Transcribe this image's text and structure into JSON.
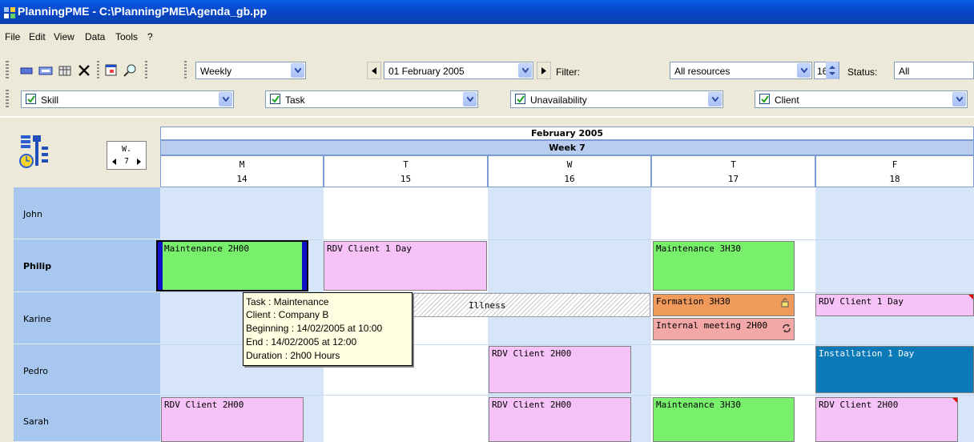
{
  "window": {
    "title": "PlanningPME - C:\\PlanningPME\\Agenda_gb.pp"
  },
  "menu": [
    "File",
    "Edit",
    "View",
    "Data",
    "Tools",
    "?"
  ],
  "toolbar": {
    "view_mode": "Weekly",
    "date": "01  February  2005",
    "filter_label": "Filter:",
    "filter_value": "All resources",
    "count_value": "16",
    "status_label": "Status:",
    "status_value": "All"
  },
  "filters": [
    {
      "label": "Skill",
      "checked": true
    },
    {
      "label": "Task",
      "checked": true
    },
    {
      "label": "Unavailability",
      "checked": true
    },
    {
      "label": "Client",
      "checked": true
    }
  ],
  "week_nav": {
    "label": "W.",
    "value": "7"
  },
  "calendar": {
    "month": "February 2005",
    "week": "Week 7",
    "days": [
      {
        "letter": "M",
        "num": "14"
      },
      {
        "letter": "T",
        "num": "15"
      },
      {
        "letter": "W",
        "num": "16"
      },
      {
        "letter": "T",
        "num": "17"
      },
      {
        "letter": "F",
        "num": "18"
      }
    ]
  },
  "resources": [
    "John",
    "Philip",
    "Karine",
    "Pedro",
    "Sarah"
  ],
  "tasks": [
    {
      "label": "Maintenance 2H00",
      "color": "#78f06c"
    },
    {
      "label": "RDV Client 1 Day",
      "color": "#f6c2f7"
    },
    {
      "label": "Maintenance 3H30",
      "color": "#78f06c"
    },
    {
      "label": "Illness",
      "color": "#c8c8c8"
    },
    {
      "label": "Formation 3H30",
      "color": "#ef9a5b"
    },
    {
      "label": "Internal meeting 2H00",
      "color": "#f3a7a7"
    },
    {
      "label": "RDV Client 1 Day",
      "color": "#f6c2f7"
    },
    {
      "label": "RDV Client 2H00",
      "color": "#f6c2f7"
    },
    {
      "label": "Installation 1 Day",
      "color": "#0a79b8"
    },
    {
      "label": "RDV Client 2H00",
      "color": "#f6c2f7"
    },
    {
      "label": "RDV Client 2H00",
      "color": "#f6c2f7"
    },
    {
      "label": "Maintenance 3H30",
      "color": "#78f06c"
    },
    {
      "label": "RDV Client 2H00",
      "color": "#f6c2f7"
    }
  ],
  "tooltip": {
    "task": "Task : Maintenance",
    "client": "Client : Company B",
    "beginning": "Beginning : 14/02/2005 at 10:00",
    "end": "End : 14/02/2005 at 12:00",
    "duration": "Duration : 2h00 Hours"
  }
}
